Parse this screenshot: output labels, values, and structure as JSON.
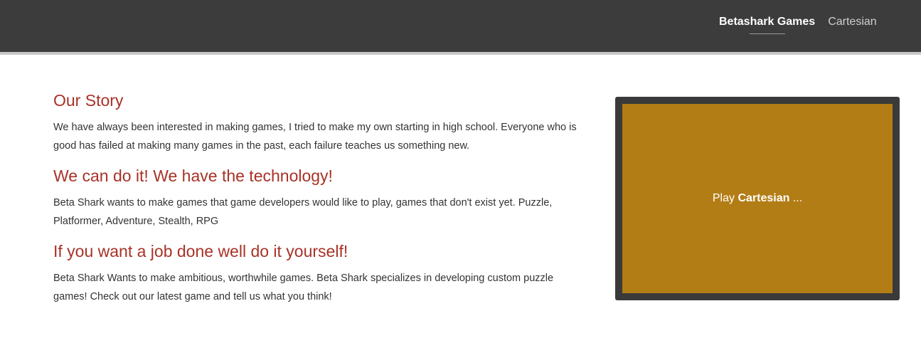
{
  "nav": {
    "items": [
      {
        "label": "Betashark Games",
        "active": true
      },
      {
        "label": "Cartesian",
        "active": false
      }
    ]
  },
  "sections": [
    {
      "heading": "Our Story",
      "text": "We have always been interested in making games, I tried to make my own starting in high school. Everyone who is good has failed at making many games in the past, each failure teaches us something new."
    },
    {
      "heading": "We can do it! We have the technology!",
      "text": "Beta Shark wants to make games that game developers would like to play, games that don't exist yet. Puzzle, Platformer, Adventure, Stealth, RPG"
    },
    {
      "heading": "If you want a job done well do it yourself!",
      "text": "Beta Shark Wants to make ambitious, worthwhile games. Beta Shark specializes in developing custom puzzle games! Check out our latest game and tell us what you think!"
    }
  ],
  "game_card": {
    "prefix": "Play ",
    "title": "Cartesian",
    "suffix": " ..."
  },
  "colors": {
    "header_bg": "#3c3c3c",
    "heading": "#a83227",
    "card_frame": "#3a3a3a",
    "card_fill": "#b37d15"
  }
}
